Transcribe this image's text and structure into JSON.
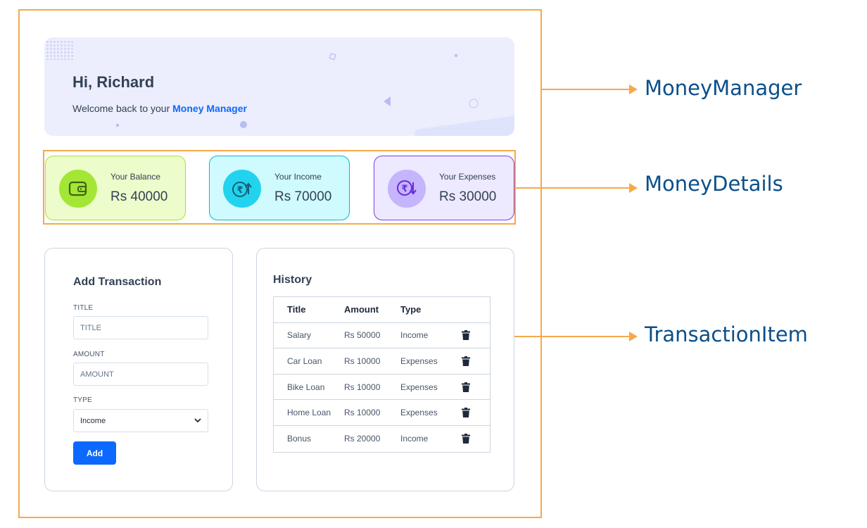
{
  "annotations": {
    "money_manager": "MoneyManager",
    "money_details": "MoneyDetails",
    "transaction_item": "TransactionItem"
  },
  "banner": {
    "greeting": "Hi, Richard",
    "welcome_text": "Welcome back to your ",
    "brand": "Money Manager"
  },
  "money_details": {
    "balance": {
      "label": "Your Balance",
      "amount": "Rs 40000",
      "icon": "wallet-icon"
    },
    "income": {
      "label": "Your Income",
      "amount": "Rs 70000",
      "icon": "rupee-up-icon"
    },
    "expenses": {
      "label": "Your Expenses",
      "amount": "Rs 30000",
      "icon": "rupee-down-icon"
    }
  },
  "add_transaction": {
    "title": "Add Transaction",
    "title_label": "TITLE",
    "title_placeholder": "TITLE",
    "amount_label": "AMOUNT",
    "amount_placeholder": "AMOUNT",
    "type_label": "TYPE",
    "type_selected": "Income",
    "add_button": "Add"
  },
  "history": {
    "title": "History",
    "columns": [
      "Title",
      "Amount",
      "Type"
    ],
    "rows": [
      {
        "title": "Salary",
        "amount": "Rs 50000",
        "type": "Income"
      },
      {
        "title": "Car Loan",
        "amount": "Rs 10000",
        "type": "Expenses"
      },
      {
        "title": "Bike Loan",
        "amount": "Rs 10000",
        "type": "Expenses"
      },
      {
        "title": "Home Loan",
        "amount": "Rs 10000",
        "type": "Expenses"
      },
      {
        "title": "Bonus",
        "amount": "Rs 20000",
        "type": "Income"
      }
    ]
  },
  "colors": {
    "accent": "#0b69ff",
    "annotation": "#f6a94a",
    "annotation_text": "#0b4f8a"
  }
}
